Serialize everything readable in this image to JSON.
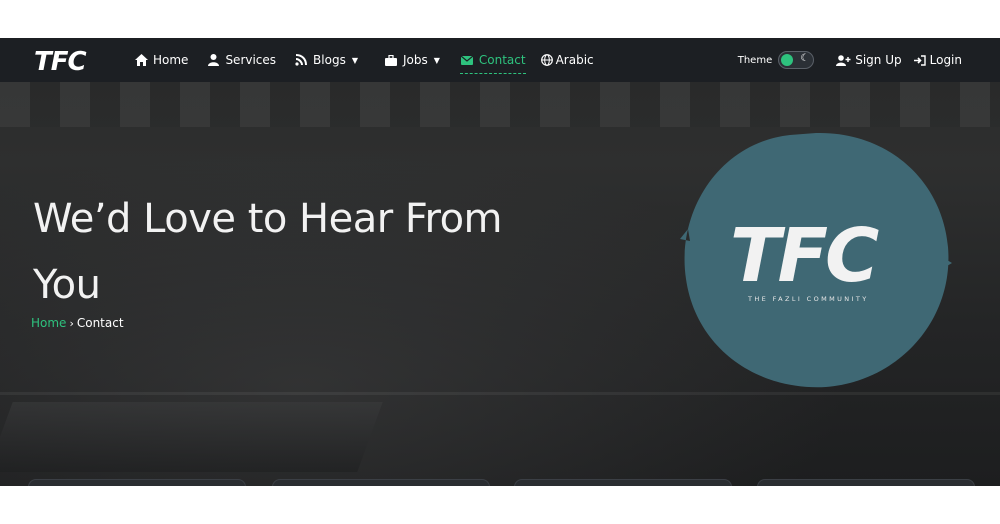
{
  "brand": "TFC",
  "nav": {
    "items": [
      {
        "label": "Home",
        "icon": "home-icon"
      },
      {
        "label": "Services",
        "icon": "user-icon"
      },
      {
        "label": "Blogs",
        "icon": "blog-icon",
        "dropdown": true
      },
      {
        "label": "Jobs",
        "icon": "briefcase-icon",
        "dropdown": true
      },
      {
        "label": "Contact",
        "icon": "envelope-icon",
        "active": true
      },
      {
        "label": "Arabic",
        "icon": "globe-icon"
      }
    ],
    "theme_label": "Theme",
    "signup_label": "Sign Up",
    "login_label": "Login"
  },
  "hero": {
    "title_line1": "We’d Love to Hear From",
    "title_line2": "You",
    "breadcrumb": {
      "home": "Home",
      "separator": "›",
      "current": "Contact"
    }
  },
  "logo": {
    "text": "TFC",
    "tagline": "THE FAZLI COMMUNITY",
    "color": "#3f6874"
  },
  "colors": {
    "accent": "#2ec27e",
    "navbar": "#1c1f23"
  }
}
